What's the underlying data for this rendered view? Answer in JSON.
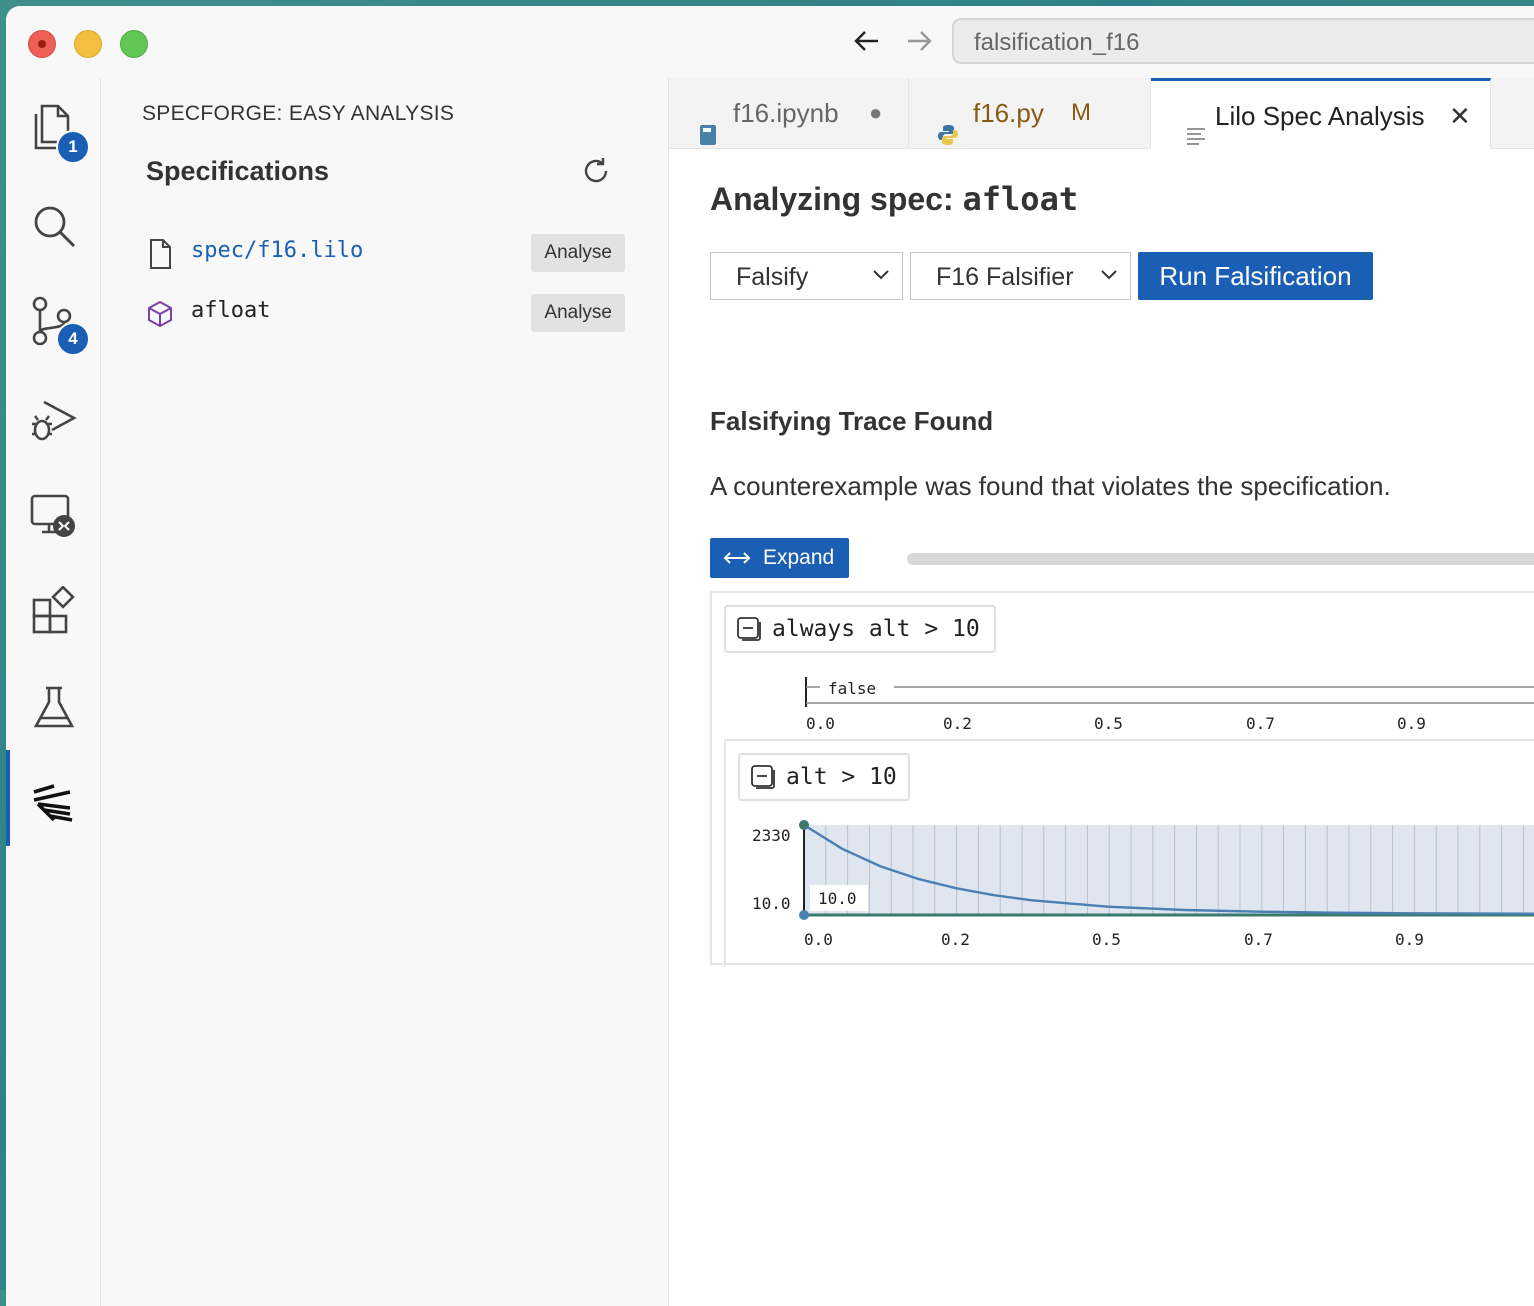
{
  "window": {
    "address": "falsification_f16"
  },
  "activity_bar": {
    "explorer_badge": "1",
    "scm_badge": "4"
  },
  "sidebar": {
    "title": "SPECFORGE: EASY ANALYSIS",
    "heading": "Specifications",
    "items": [
      {
        "label": "spec/f16.lilo",
        "button": "Analyse"
      },
      {
        "label": "afloat",
        "button": "Analyse"
      }
    ]
  },
  "tabs": [
    {
      "label": "f16.ipynb",
      "status": "●"
    },
    {
      "label": "f16.py",
      "status": "M"
    },
    {
      "label": "Lilo Spec Analysis",
      "close": "✕"
    }
  ],
  "analysis": {
    "heading_prefix": "Analyzing spec: ",
    "spec_name": "afloat",
    "mode_select": "Falsify",
    "falsifier_select": "F16 Falsifier",
    "run_button": "Run Falsification",
    "result_title": "Falsifying Trace Found",
    "result_description": "A counterexample was found that violates the specification.",
    "expand_button": "Expand"
  },
  "chart_data": [
    {
      "type": "timeline",
      "formula": "always alt > 10",
      "value_label": "false",
      "x_ticks": [
        "0.0",
        "0.2",
        "0.5",
        "0.7",
        "0.9"
      ]
    },
    {
      "type": "line",
      "formula": "alt > 10",
      "y_ticks": [
        "2330",
        "10.0"
      ],
      "threshold_label": "10.0",
      "x_ticks": [
        "0.0",
        "0.2",
        "0.5",
        "0.7",
        "0.9"
      ],
      "ylim": [
        10,
        2330
      ],
      "series": [
        {
          "x": [
            0.0,
            0.05,
            0.1,
            0.15,
            0.2,
            0.25,
            0.3,
            0.4,
            0.5,
            0.6,
            0.7,
            0.8,
            0.9,
            1.0
          ],
          "y": [
            2330,
            1720,
            1270,
            940,
            700,
            520,
            390,
            225,
            140,
            95,
            70,
            55,
            45,
            40
          ]
        }
      ]
    }
  ]
}
